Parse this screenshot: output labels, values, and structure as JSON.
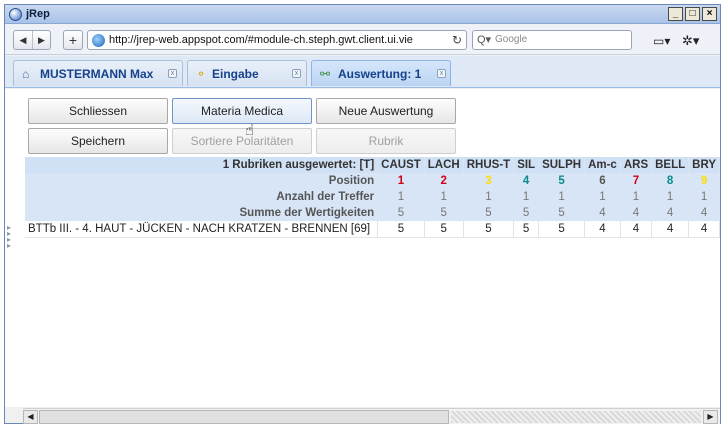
{
  "window": {
    "title": "jRep"
  },
  "browser": {
    "url": "http://jrep-web.appspot.com/#module-ch.steph.gwt.client.ui.vie",
    "search_placeholder": "Google"
  },
  "tabs": [
    {
      "label": "MUSTERMANN Max",
      "icon": "home-icon"
    },
    {
      "label": "Eingabe",
      "icon": "edit-icon"
    },
    {
      "label": "Auswertung: 1",
      "icon": "chart-icon",
      "active": true
    }
  ],
  "toolbar": {
    "row1": [
      "Schliessen",
      "Materia Medica",
      "Neue Auswertung"
    ],
    "row2": [
      "Speichern",
      "Sortiere Polaritäten",
      "Rubrik"
    ]
  },
  "grid": {
    "summary": "1 Rubriken ausgewertet: [T]",
    "remedies": [
      "CAUST",
      "LACH",
      "RHUS-T",
      "SIL",
      "SULPH",
      "Am-c",
      "ARS",
      "BELL",
      "BRY"
    ],
    "rows": [
      {
        "label": "Position",
        "values": [
          "1",
          "2",
          "3",
          "4",
          "5",
          "6",
          "7",
          "8",
          "9"
        ]
      },
      {
        "label": "Anzahl der Treffer",
        "values": [
          "1",
          "1",
          "1",
          "1",
          "1",
          "1",
          "1",
          "1",
          "1"
        ]
      },
      {
        "label": "Summe der Wertigkeiten",
        "values": [
          "5",
          "5",
          "5",
          "5",
          "5",
          "4",
          "4",
          "4",
          "4"
        ]
      }
    ],
    "data_rows": [
      {
        "label": "BTTb  III. - 4. HAUT - JÜCKEN - NACH KRATZEN - BRENNEN  [69]",
        "values": [
          "5",
          "5",
          "5",
          "5",
          "5",
          "4",
          "4",
          "4",
          "4"
        ]
      }
    ]
  },
  "colors": {
    "accent": "#15428b",
    "header_bg": "#d7e5f6",
    "red": "#c8102e",
    "green": "#2eb82e",
    "teal": "#0a8a8a",
    "yellow": "#ffdd00"
  }
}
